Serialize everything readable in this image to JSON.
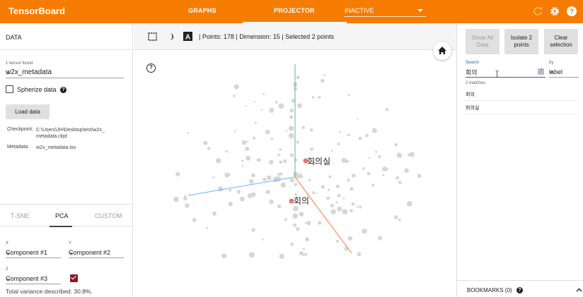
{
  "topbar": {
    "brand": "TensorBoard",
    "tabs": [
      {
        "label": "GRAPHS"
      },
      {
        "label": "PROJECTOR"
      }
    ],
    "inactive_label": "INACTIVE",
    "bg_color": "#f57c00"
  },
  "left": {
    "section_title": "DATA",
    "tensor_found": "1 tensor found",
    "tensor_name": "w2x_metadata",
    "spherize_label": "Spherize data",
    "load_button": "Load data",
    "checkpoint_label": "Checkpoint:",
    "checkpoint_value": "C:\\Users\\JH\\Desktop\\test\\w2x_",
    "checkpoint_value2": "metadata.ckpt",
    "metadata_label": "Metadata:",
    "metadata_value": "w2x_metadata.tsv",
    "projection_tabs": [
      {
        "label": "T-SNE"
      },
      {
        "label": "PCA"
      },
      {
        "label": "CUSTOM"
      }
    ],
    "x_label": "X",
    "y_label": "Y",
    "z_label": "Z",
    "x_component": "Component #1",
    "y_component": "Component #2",
    "z_component": "Component #3",
    "variance": "Total variance described: 30.8%."
  },
  "center": {
    "status": "| Points: 178 | Dimension: 15 | Selected 2 points",
    "help_glyph": "?",
    "selected_labels": [
      "회의실",
      "회의"
    ],
    "highlight_color": "#e57373",
    "axis_colors": {
      "x": "#ff7043",
      "y": "#66bb6a",
      "z": "#64b5f6"
    }
  },
  "right": {
    "show_all": "Show All Data",
    "isolate": "Isolate 2 points",
    "clear": "Clear selection",
    "search_label": "Search",
    "search_value": "회의",
    "regex_glyph": ".*",
    "by_label": "by",
    "by_value": "label",
    "matches_text": "2 matches.",
    "matches": [
      "회의",
      "회의실"
    ],
    "bookmarks": "BOOKMARKS (0)"
  }
}
